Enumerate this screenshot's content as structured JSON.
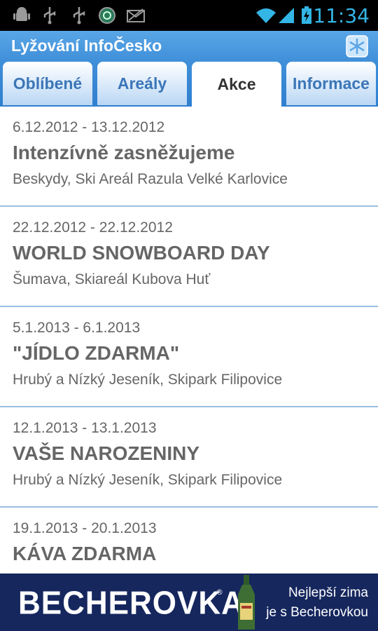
{
  "status_bar": {
    "time": "11:34",
    "icons": [
      "android-debug-icon",
      "usb-icon",
      "usb-icon",
      "sync-icon",
      "missed-mail-icon",
      "wifi-icon",
      "signal-icon",
      "battery-charging-icon"
    ],
    "accent_color": "#33b5e5"
  },
  "app": {
    "title": "Lyžování InfoČesko",
    "header_color": "#3f8fd9"
  },
  "tabs": [
    {
      "label": "Oblíbené",
      "active": false
    },
    {
      "label": "Areály",
      "active": false
    },
    {
      "label": "Akce",
      "active": true
    },
    {
      "label": "Informace",
      "active": false
    }
  ],
  "events": [
    {
      "date": "6.12.2012 - 13.12.2012",
      "name": "Intenzívně zasněžujeme",
      "place": "Beskydy, Ski Areál Razula Velké Karlovice"
    },
    {
      "date": "22.12.2012 - 22.12.2012",
      "name": "WORLD SNOWBOARD DAY",
      "place": "Šumava, Skiareál Kubova Huť"
    },
    {
      "date": "5.1.2013 - 6.1.2013",
      "name": "\"JÍDLO ZDARMA\"",
      "place": "Hrubý a Nízký Jeseník, Skipark Filipovice"
    },
    {
      "date": "12.1.2013 - 13.1.2013",
      "name": "VAŠE NAROZENINY",
      "place": "Hrubý a Nízký Jeseník, Skipark Filipovice"
    },
    {
      "date": "19.1.2013 - 20.1.2013",
      "name": "KÁVA ZDARMA",
      "place": ""
    }
  ],
  "ad": {
    "brand": "BECHEROVKA",
    "slogan_line1": "Nejlepší zima",
    "slogan_line2": "je s Becherovkou",
    "background_color": "#16275e"
  }
}
